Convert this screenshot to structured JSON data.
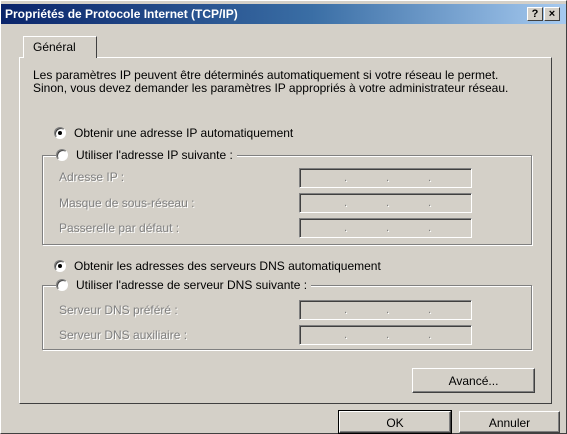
{
  "window": {
    "title": "Propriétés de Protocole Internet (TCP/IP)",
    "help_button": "?",
    "close_button": "×"
  },
  "tabs": [
    {
      "label": "Général"
    }
  ],
  "intro_text": "Les paramètres IP peuvent être déterminés automatiquement si votre réseau le permet. Sinon, vous devez demander les paramètres IP appropriés à votre administrateur réseau.",
  "ip_section": {
    "auto_radio": {
      "label": "Obtenir une adresse IP automatiquement",
      "selected": true
    },
    "manual_radio": {
      "label": "Utiliser l'adresse IP suivante :",
      "selected": false
    },
    "fields": [
      {
        "label": "Adresse IP :",
        "value": ". . ."
      },
      {
        "label": "Masque de sous-réseau :",
        "value": ". . ."
      },
      {
        "label": "Passerelle par défaut :",
        "value": ". . ."
      }
    ]
  },
  "dns_section": {
    "auto_radio": {
      "label": "Obtenir les adresses des serveurs DNS automatiquement",
      "selected": true
    },
    "manual_radio": {
      "label": "Utiliser l'adresse de serveur DNS suivante :",
      "selected": false
    },
    "fields": [
      {
        "label": "Serveur DNS préféré :",
        "value": ". . ."
      },
      {
        "label": "Serveur DNS auxiliaire :",
        "value": ". . ."
      }
    ]
  },
  "buttons": {
    "advanced": "Avancé...",
    "ok": "OK",
    "cancel": "Annuler"
  },
  "colors": {
    "title_bar_start": "#0a246a",
    "title_bar_end": "#a6caf0",
    "face": "#d4d0c8",
    "disabled_text": "#808080"
  }
}
